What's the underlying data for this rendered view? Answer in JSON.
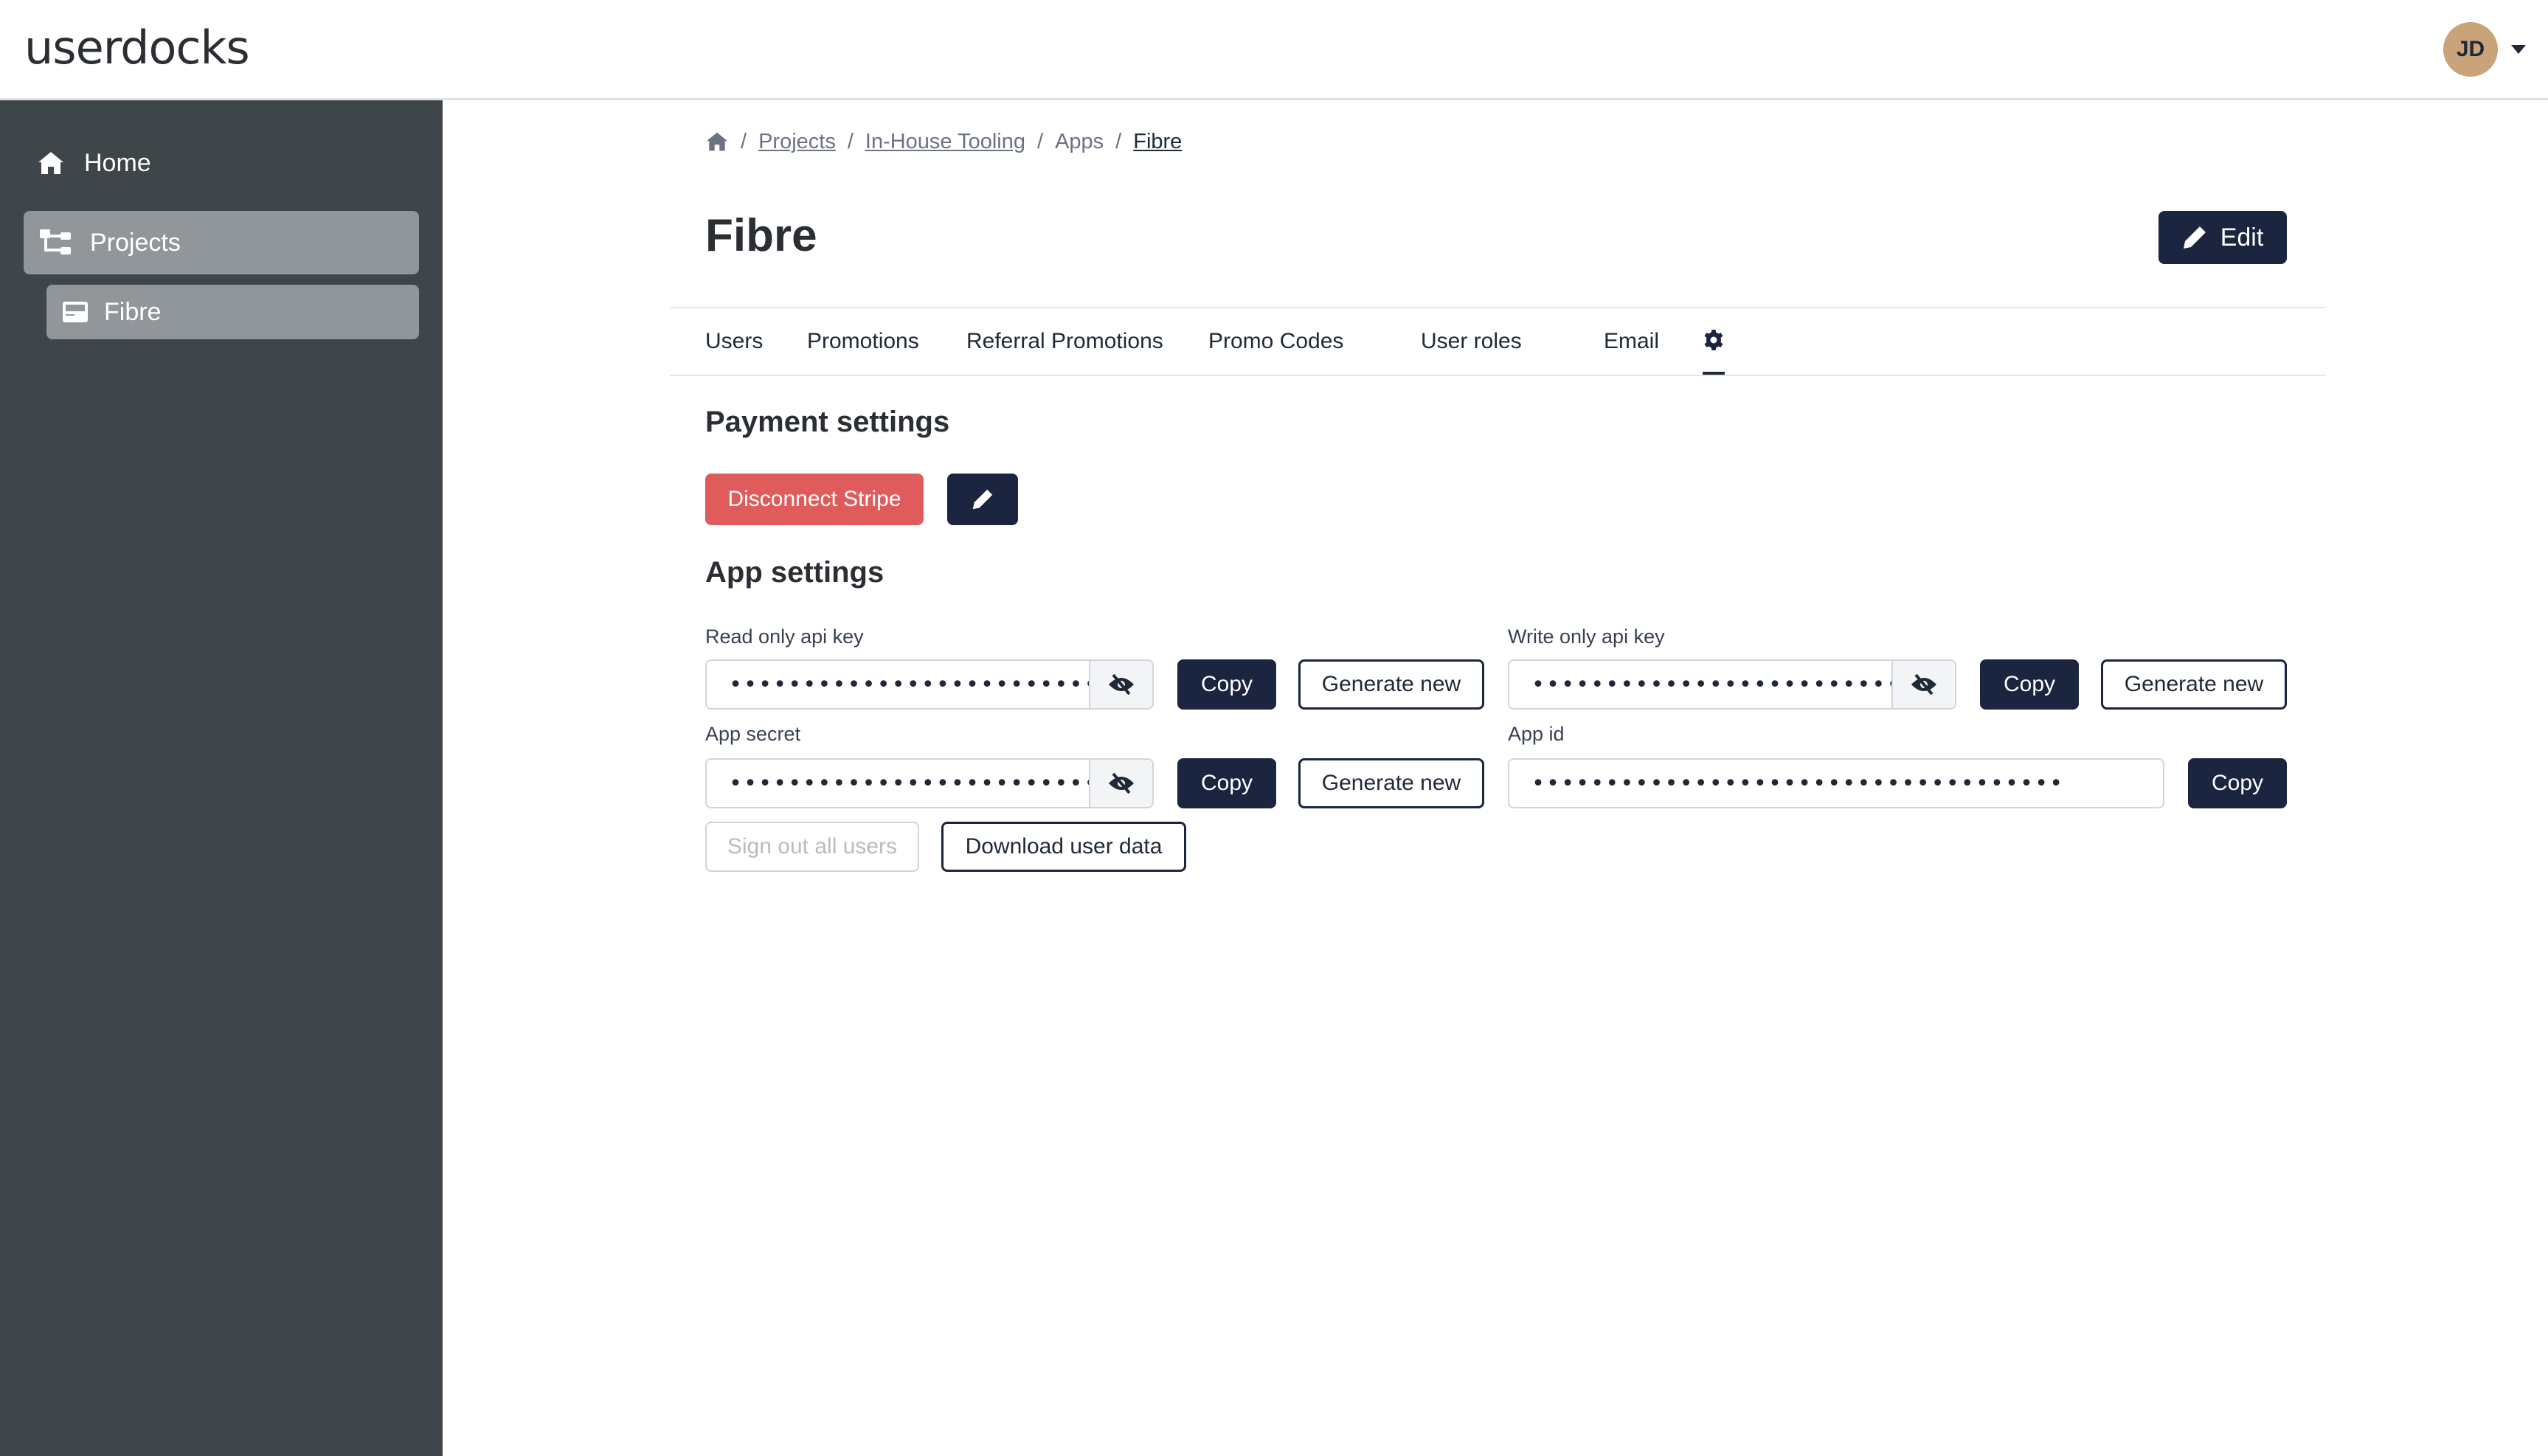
{
  "header": {
    "brand": "userdocks",
    "user_initials": "JD"
  },
  "sidebar": {
    "items": [
      {
        "label": "Home",
        "icon": "home-icon"
      },
      {
        "label": "Projects",
        "icon": "sitemap-icon",
        "active": true
      },
      {
        "label": "Fibre",
        "icon": "app-card-icon",
        "active": true
      }
    ]
  },
  "breadcrumb": {
    "items": [
      "Projects",
      "In-House Tooling",
      "Apps",
      "Fibre"
    ],
    "separator": "/"
  },
  "page": {
    "title": "Fibre",
    "edit_label": "Edit"
  },
  "tabs": [
    {
      "label": "Users"
    },
    {
      "label": "Promotions"
    },
    {
      "label": "Referral Promotions"
    },
    {
      "label": "Promo Codes"
    },
    {
      "label": "User roles"
    },
    {
      "label": "Email"
    },
    {
      "label": "",
      "icon": "gear-icon",
      "active": true
    }
  ],
  "payment": {
    "title": "Payment settings",
    "disconnect_label": "Disconnect Stripe"
  },
  "app_settings": {
    "title": "App settings",
    "read_key": {
      "label": "Read only api key",
      "value": "••••••••••••••••••••••••••••••••••••••••••••",
      "copy": "Copy",
      "generate": "Generate new"
    },
    "write_key": {
      "label": "Write only api key",
      "value": "••••••••••••••••••••••••••••••••••••••••••••",
      "copy": "Copy",
      "generate": "Generate new"
    },
    "app_secret": {
      "label": "App secret",
      "value": "••••••••••••••••••••••••••••••••••••••••••••",
      "copy": "Copy",
      "generate": "Generate new"
    },
    "app_id": {
      "label": "App id",
      "value": "••••••••••••••••••••••••••••••••••••",
      "copy": "Copy"
    },
    "sign_out_label": "Sign out all users",
    "download_label": "Download user data"
  },
  "colors": {
    "sidebar_bg": "#3f4649",
    "sidebar_active": "#90969a",
    "primary": "#1b2540",
    "danger": "#e05c5c",
    "avatar": "#c9a379"
  }
}
